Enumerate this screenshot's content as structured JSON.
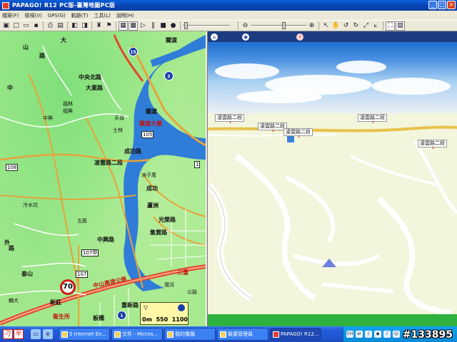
{
  "window": {
    "title": "PAPAGO! R12 PC版-臺灣地圖PC版",
    "controls": [
      "_",
      "□",
      "×"
    ]
  },
  "menu": [
    "檔案(F)",
    "檢視(V)",
    "GPS(G)",
    "軌跡(T)",
    "工具(L)",
    "說明(H)"
  ],
  "leftmap": {
    "labels": [
      {
        "t": "山",
        "c": ""
      },
      {
        "t": "路",
        "c": ""
      },
      {
        "t": "大",
        "c": ""
      },
      {
        "t": "中",
        "c": ""
      },
      {
        "t": "中央北路",
        "c": ""
      },
      {
        "t": "中興",
        "c": ""
      },
      {
        "t": "福林",
        "c": ""
      },
      {
        "t": "福興",
        "c": ""
      },
      {
        "t": "大業路",
        "c": ""
      },
      {
        "t": "天母",
        "c": ""
      },
      {
        "t": "士林",
        "c": ""
      },
      {
        "t": "關渡",
        "c": ""
      },
      {
        "t": "關渡",
        "c": ""
      },
      {
        "t": "關渡大橋",
        "c": "red"
      },
      {
        "t": "成功路",
        "c": ""
      },
      {
        "t": "凌雲路二段",
        "c": ""
      },
      {
        "t": "洲子尾",
        "c": ""
      },
      {
        "t": "成功",
        "c": ""
      },
      {
        "t": "冷水坑",
        "c": ""
      },
      {
        "t": "五股",
        "c": ""
      },
      {
        "t": "中興路",
        "c": ""
      },
      {
        "t": "蘆洲",
        "c": ""
      },
      {
        "t": "光榮路",
        "c": ""
      },
      {
        "t": "集賢路",
        "c": ""
      },
      {
        "t": "路",
        "c": ""
      },
      {
        "t": "外",
        "c": ""
      },
      {
        "t": "泰山",
        "c": ""
      },
      {
        "t": "新莊",
        "c": ""
      },
      {
        "t": "輔大",
        "c": ""
      },
      {
        "t": "中山高速公路",
        "c": "red"
      },
      {
        "t": "重新路",
        "c": ""
      },
      {
        "t": "三重",
        "c": "red"
      },
      {
        "t": "環河",
        "c": ""
      },
      {
        "t": "公路",
        "c": ""
      },
      {
        "t": "板橋",
        "c": ""
      },
      {
        "t": "衛生所",
        "c": "red"
      }
    ],
    "road_numbers": [
      "108",
      "105",
      "107甲",
      "107",
      "1"
    ],
    "shields": [
      "15",
      "2",
      "1"
    ],
    "speed_limit": "70",
    "scale": {
      "left": "0m",
      "mid": "550",
      "right": "1100"
    }
  },
  "rightview": {
    "street_signs": [
      "凌雲路二段",
      "凌雲路二段",
      "凌雲路二段",
      "凌雲路二段",
      "凌雲路二段"
    ],
    "header_icons": [
      "home-icon",
      "compass-icon",
      "gps-signal-icon"
    ]
  },
  "taskbar": {
    "ime": [
      "刁",
      "半"
    ],
    "tasks": [
      {
        "label": "5 Internet Ex..."
      },
      {
        "label": "文件 - Micros..."
      },
      {
        "label": "我的電腦"
      },
      {
        "label": "裝置管理員"
      },
      {
        "label": "PAPAGO! R12..."
      }
    ],
    "tray_lang": "CH",
    "watermark": "#133895"
  },
  "colors": {
    "title_bar": "#0842b0",
    "map_green": "#a7e98f",
    "river": "#2f7dd8",
    "highway": "#e04a2a",
    "sky": "#4c92e2",
    "ground": "#f3f5dc"
  }
}
